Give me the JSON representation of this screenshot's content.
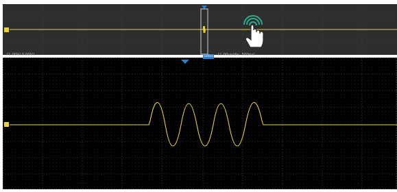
{
  "scope": {
    "vertical_scale_label": "[1.00V/,0.00V]",
    "timebase_label": "[1.00us/div, 500ns]",
    "timebase_badge": "500ns",
    "overview_window_label": "500ns"
  },
  "colors": {
    "trace": "#e8d23a",
    "grid": "#4a4a4a",
    "overview_bg": "#2e2e2e",
    "main_bg": "#000000",
    "marker": "#2f7fd0",
    "hand_glow": "#2ea88e"
  },
  "icons": {
    "trigger_marker": "triangle-down-icon",
    "channel_marker": "channel-1-marker-icon",
    "touch_gesture": "tap-hand-icon"
  }
}
